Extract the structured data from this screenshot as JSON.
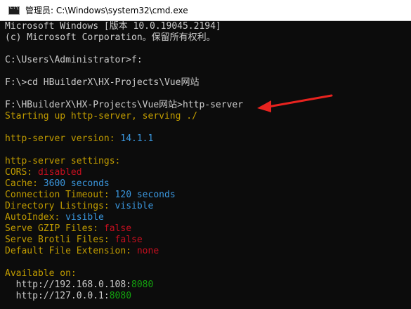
{
  "window": {
    "title": "管理员: C:\\Windows\\system32\\cmd.exe",
    "icon": "cmd-icon"
  },
  "console": {
    "lines": [
      [
        {
          "text": "Microsoft Windows [版本 10.0.19045.2194]",
          "color": "gray"
        }
      ],
      [
        {
          "text": "(c) Microsoft Corporation。保留所有权利。",
          "color": "gray"
        }
      ],
      [],
      [
        {
          "text": "C:\\Users\\Administrator>f:",
          "color": "gray"
        }
      ],
      [],
      [
        {
          "text": "F:\\>cd HBuilderX\\HX-Projects\\Vue网站",
          "color": "gray"
        }
      ],
      [],
      [
        {
          "text": "F:\\HBuilderX\\HX-Projects\\Vue网站>http-server",
          "color": "gray"
        }
      ],
      [
        {
          "text": "Starting up http-server, serving ./",
          "color": "yellow"
        }
      ],
      [],
      [
        {
          "text": "http-server version: ",
          "color": "yellow"
        },
        {
          "text": "14.1.1",
          "color": "cyan"
        }
      ],
      [],
      [
        {
          "text": "http-server settings:",
          "color": "yellow"
        }
      ],
      [
        {
          "text": "CORS: ",
          "color": "yellow"
        },
        {
          "text": "disabled",
          "color": "red"
        }
      ],
      [
        {
          "text": "Cache: ",
          "color": "yellow"
        },
        {
          "text": "3600 seconds",
          "color": "cyan"
        }
      ],
      [
        {
          "text": "Connection Timeout: ",
          "color": "yellow"
        },
        {
          "text": "120 seconds",
          "color": "cyan"
        }
      ],
      [
        {
          "text": "Directory Listings: ",
          "color": "yellow"
        },
        {
          "text": "visible",
          "color": "cyan"
        }
      ],
      [
        {
          "text": "AutoIndex: ",
          "color": "yellow"
        },
        {
          "text": "visible",
          "color": "cyan"
        }
      ],
      [
        {
          "text": "Serve GZIP Files: ",
          "color": "yellow"
        },
        {
          "text": "false",
          "color": "red"
        }
      ],
      [
        {
          "text": "Serve Brotli Files: ",
          "color": "yellow"
        },
        {
          "text": "false",
          "color": "red"
        }
      ],
      [
        {
          "text": "Default File Extension: ",
          "color": "yellow"
        },
        {
          "text": "none",
          "color": "red"
        }
      ],
      [],
      [
        {
          "text": "Available on:",
          "color": "yellow"
        }
      ],
      [
        {
          "text": "  http://192.168.0.108:",
          "color": "gray"
        },
        {
          "text": "8080",
          "color": "green"
        }
      ],
      [
        {
          "text": "  http://127.0.0.1:",
          "color": "gray"
        },
        {
          "text": "8080",
          "color": "green"
        }
      ]
    ]
  },
  "annotation": {
    "arrow_color": "#e8231f"
  }
}
